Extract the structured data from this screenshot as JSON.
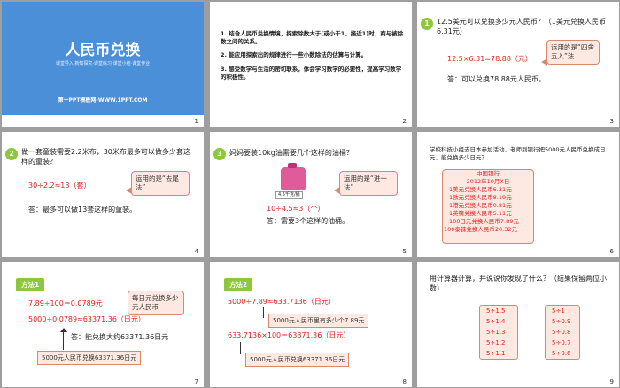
{
  "s1": {
    "title": "人民币兑换",
    "subtitle": "课堂导入·新知探究·课堂练习·课堂小结·课堂作业",
    "footer": "第一PPT模板网-WWW.1PPT.COM",
    "num": "1"
  },
  "s2": {
    "items": [
      "1. 结合人民币兑换情境，探索除数大于(或小于1、接近1)时，商与被除数之间的关系。",
      "2. 能应用探索出的规律进行一些小数除法的估算与计算。",
      "3. 感受数学与生活的密切联系，体会学习数学的必要性，提高学习数学的积极性。"
    ],
    "num": "2"
  },
  "s3": {
    "badge": "1",
    "q": "12.5美元可以兑换多少元人民币？（1美元兑换人民币6.31元）",
    "eq": "12.5×6.31≈78.88（元）",
    "ans": "答：可以兑换78.88元人民币。",
    "callout": "运用的是“四舍五入”法",
    "num": "3"
  },
  "s4": {
    "badge": "2",
    "q": "做一套童装需要2.2米布，30米布最多可以做多少套这样的童装？",
    "eq": "30÷2.2≈13（套）",
    "ans": "答：最多可以做13套这样的童装。",
    "callout": "运用的是“去尾法”",
    "num": "4"
  },
  "s5": {
    "badge": "3",
    "q": "妈妈要装10kg油需要几个这样的油桶？",
    "jug": "4.5千克/桶",
    "eq": "10÷4.5≈3（个）",
    "ans": "答：需要3个这样的油桶。",
    "callout": "运用的是“进一法”",
    "num": "5"
  },
  "s6": {
    "q": "学校科技小组去日本参加活动，老师到银行把5000元人民币兑换成日元，能兑换多少日元？",
    "bank": "中国银行",
    "date": "2012年10月X日",
    "rates": [
      "1美元兑换人民币6.31元",
      "1欧元兑换人民币8.19元",
      "1港元兑换人民币0.81元",
      "1英镑兑换人民币5.11元",
      "100日元兑换人民币7.89元",
      "100泰铢兑换人民币20.32元"
    ],
    "num": "6"
  },
  "s7": {
    "tag": "方法1",
    "eq1": "7.89÷100＝0.0789元",
    "eq2": "5000÷0.0789≈63371.36（日元）",
    "ans": "答：能兑换大约63371.36日元",
    "callout": "每日元兑换多少元人民币",
    "box": "5000元人民币兑换63371.36日元",
    "num": "7"
  },
  "s8": {
    "tag": "方法2",
    "eq1": "5000÷7.89≈633.7136（日元）",
    "box1": "5000元人民币里有多少个7.89元",
    "eq2": "633.7136×100＝63371.36（日元）",
    "box2": "5000元人民币兑换63371.36日元",
    "num": "8"
  },
  "s9": {
    "q": "用计算器计算，并说说你发现了什么？（结果保留两位小数）",
    "left": [
      "5÷1.5",
      "5÷1.4",
      "5÷1.3",
      "5÷1.2",
      "5÷1.1"
    ],
    "right": [
      "5÷1",
      "5÷0.9",
      "5÷0.8",
      "5÷0.7",
      "5÷0.6"
    ],
    "num": "9"
  }
}
